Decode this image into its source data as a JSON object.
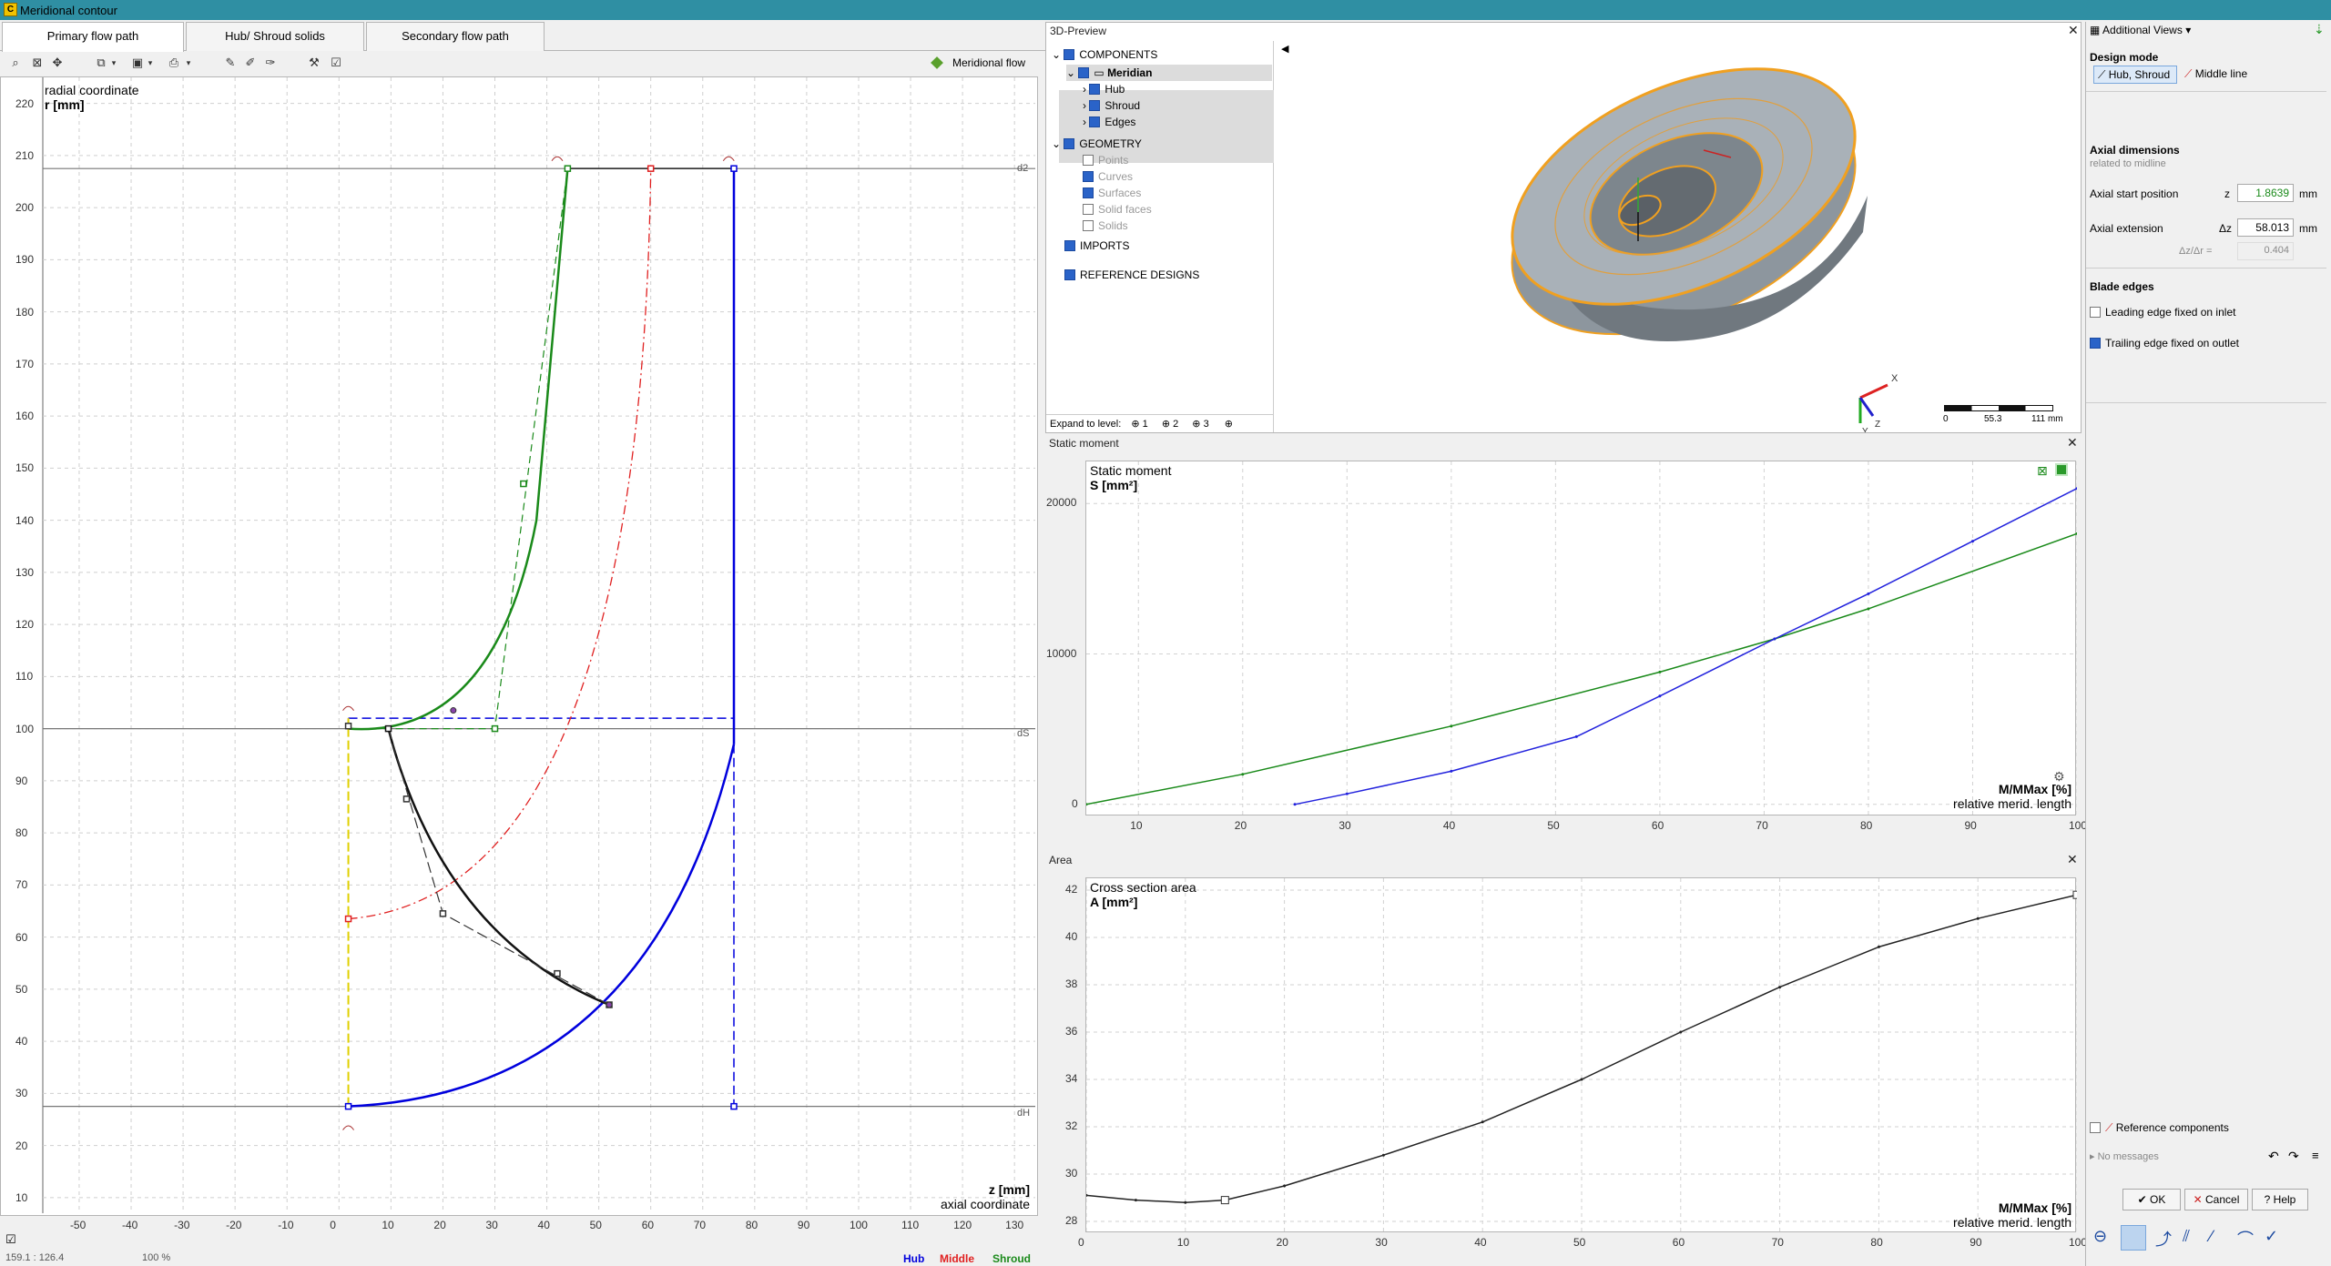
{
  "window": {
    "title": "Meridional contour",
    "app_icon": "C",
    "status_coords": "159.1 : 126.4",
    "status_zoom": "100 %"
  },
  "tabs": [
    {
      "label": "Primary flow path"
    },
    {
      "label": "Hub/ Shroud solids"
    },
    {
      "label": "Secondary flow path"
    }
  ],
  "toolbar": {
    "mode_label": "Meridional flow"
  },
  "meridional_plot": {
    "ylabel_line1": "radial coordinate",
    "ylabel_line2": "r [mm]",
    "xlabel_line1": "z [mm]",
    "xlabel_line2": "axial coordinate",
    "xticks": [
      "-50",
      "-40",
      "-30",
      "-20",
      "-10",
      "0",
      "10",
      "20",
      "30",
      "40",
      "50",
      "60",
      "70",
      "80",
      "90",
      "100",
      "110",
      "120",
      "130"
    ],
    "yticks": [
      "10",
      "20",
      "30",
      "40",
      "50",
      "60",
      "70",
      "80",
      "90",
      "100",
      "110",
      "120",
      "130",
      "140",
      "150",
      "160",
      "170",
      "180",
      "190",
      "200",
      "210",
      "220"
    ],
    "ref_lines": {
      "d2": "d2",
      "ds": "dS",
      "dh": "dH"
    },
    "legend": {
      "hub": "Hub",
      "middle": "Middle",
      "shroud": "Shroud"
    },
    "colors": {
      "hub": "#0000dd",
      "middle": "#e02020",
      "shroud": "#1a8a1a",
      "yellow": "#e0d000"
    }
  },
  "preview": {
    "title": "3D-Preview",
    "tree": {
      "components": "COMPONENTS",
      "meridian": "Meridian",
      "hub": "Hub",
      "shroud": "Shroud",
      "edges": "Edges",
      "geometry": "GEOMETRY",
      "points": "Points",
      "curves": "Curves",
      "surfaces": "Surfaces",
      "solid_faces": "Solid faces",
      "solids": "Solids",
      "imports": "IMPORTS",
      "reference_designs": "REFERENCE DESIGNS"
    },
    "expand_label": "Expand to level:",
    "expand_levels": [
      "1",
      "2",
      "3"
    ],
    "axes": {
      "x": "X",
      "y": "Y",
      "z": "Z"
    },
    "scale": {
      "s0": "0",
      "s1": "55.3",
      "s2": "111 mm"
    }
  },
  "static_moment": {
    "panel_title": "Static moment",
    "title": "Static moment",
    "ylabel": "S [mm²]",
    "xlabel_line1": "M/MMax [%]",
    "xlabel_line2": "relative merid. length",
    "xticks": [
      "10",
      "20",
      "30",
      "40",
      "50",
      "60",
      "70",
      "80",
      "90",
      "100"
    ],
    "yticks": [
      "0",
      "10000",
      "20000"
    ]
  },
  "area": {
    "panel_title": "Area",
    "title": "Cross section area",
    "ylabel": "A [mm²]",
    "xlabel_line1": "M/MMax [%]",
    "xlabel_line2": "relative merid. length",
    "xticks": [
      "0",
      "10",
      "20",
      "30",
      "40",
      "50",
      "60",
      "70",
      "80",
      "90",
      "100"
    ],
    "yticks": [
      "28",
      "30",
      "32",
      "34",
      "36",
      "38",
      "40",
      "42"
    ]
  },
  "right_panel": {
    "additional_views": "Additional Views",
    "design_mode": "Design mode",
    "mode_hub_shroud": "Hub, Shroud",
    "mode_middle": "Middle line",
    "axial_dimensions": "Axial dimensions",
    "related_to": "related to midline",
    "axial_start_label": "Axial start position",
    "axial_start_sym": "z",
    "axial_start_value": "1.8639",
    "axial_start_unit": "mm",
    "axial_ext_label": "Axial extension",
    "axial_ext_sym": "Δz",
    "axial_ext_value": "58.013",
    "axial_ext_unit": "mm",
    "ratio_label": "Δz/Δr =",
    "ratio_value": "0.404",
    "blade_edges": "Blade edges",
    "leading_edge": "Leading edge fixed on inlet",
    "trailing_edge": "Trailing edge fixed on outlet",
    "reference_components": "Reference components",
    "no_messages": "No messages",
    "ok": "OK",
    "cancel": "Cancel",
    "help": "Help"
  },
  "chart_data": [
    {
      "type": "line",
      "title": "Static moment",
      "ylabel": "S [mm²]",
      "xlabel": "M/MMax [%]",
      "xlim": [
        5,
        100
      ],
      "ylim": [
        -800,
        22800
      ],
      "series": [
        {
          "color": "#1a8a1a",
          "x": [
            5,
            20,
            40,
            60,
            71,
            80,
            100
          ],
          "y": [
            0,
            2000,
            5200,
            8800,
            11000,
            13000,
            18000
          ]
        },
        {
          "color": "#2222dd",
          "x": [
            25,
            30,
            40,
            52,
            60,
            71,
            80,
            90,
            100
          ],
          "y": [
            0,
            700,
            2200,
            4500,
            7200,
            11000,
            14000,
            17500,
            21000
          ]
        }
      ]
    },
    {
      "type": "line",
      "title": "Cross section area",
      "ylabel": "A [mm²]",
      "xlabel": "M/MMax [%]",
      "xlim": [
        0,
        100
      ],
      "ylim": [
        27.5,
        42.5
      ],
      "series": [
        {
          "color": "#222222",
          "x": [
            0,
            5,
            10,
            14,
            20,
            30,
            40,
            50,
            60,
            70,
            80,
            90,
            100
          ],
          "y": [
            29.1,
            28.9,
            28.8,
            28.9,
            29.5,
            30.8,
            32.2,
            34.0,
            36.0,
            37.9,
            39.6,
            40.8,
            41.8
          ]
        }
      ]
    }
  ]
}
